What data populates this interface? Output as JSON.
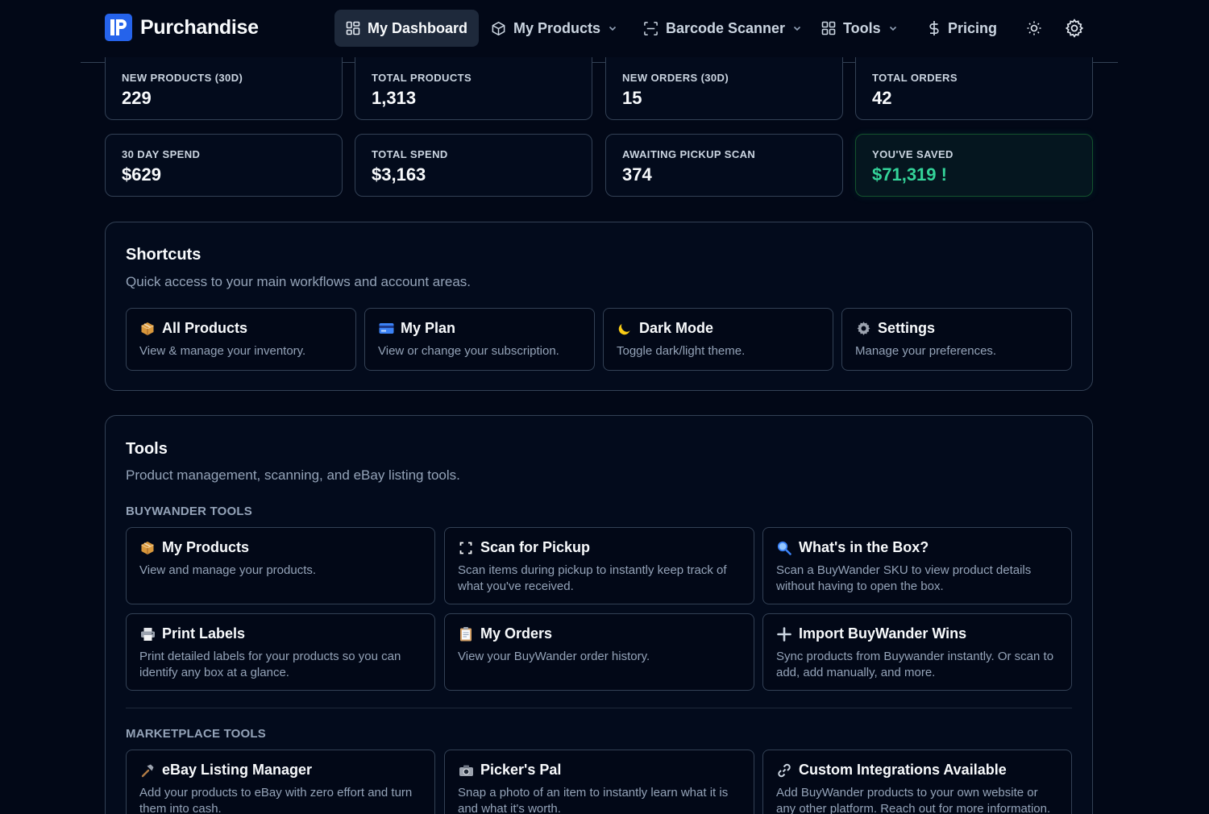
{
  "nav": {
    "brand": "Purchandise",
    "items": [
      {
        "label": "My Dashboard",
        "icon": "dashboard-icon",
        "active": true
      },
      {
        "label": "My Products",
        "icon": "box-icon",
        "dropdown": true
      },
      {
        "label": "Barcode Scanner",
        "icon": "scan-icon",
        "dropdown": true
      },
      {
        "label": "Tools",
        "icon": "grid-icon",
        "dropdown": true
      },
      {
        "label": "Pricing",
        "icon": "dollar-icon"
      }
    ],
    "theme_icon": "sun-icon",
    "settings_icon": "gear-icon"
  },
  "stats": {
    "new_products": {
      "label": "NEW PRODUCTS (30D)",
      "value": "229"
    },
    "total_products": {
      "label": "TOTAL PRODUCTS",
      "value": "1,313"
    },
    "new_orders": {
      "label": "NEW ORDERS (30D)",
      "value": "15"
    },
    "total_orders": {
      "label": "TOTAL ORDERS",
      "value": "42"
    },
    "spend_30": {
      "label": "30 DAY SPEND",
      "value": "$629"
    },
    "total_spend": {
      "label": "TOTAL SPEND",
      "value": "$3,163"
    },
    "awaiting": {
      "label": "AWAITING PICKUP SCAN",
      "value": "374"
    },
    "saved": {
      "label": "YOU'VE SAVED",
      "value": "$71,319 !"
    }
  },
  "shortcuts": {
    "title": "Shortcuts",
    "subtitle": "Quick access to your main workflows and account areas.",
    "items": [
      {
        "title": "All Products",
        "desc": "View & manage your inventory.",
        "icon": "package-icon"
      },
      {
        "title": "My Plan",
        "desc": "View or change your subscription.",
        "icon": "credit-card-icon"
      },
      {
        "title": "Dark Mode",
        "desc": "Toggle dark/light theme.",
        "icon": "moon-icon"
      },
      {
        "title": "Settings",
        "desc": "Manage your preferences.",
        "icon": "gear-icon"
      }
    ]
  },
  "tools": {
    "title": "Tools",
    "subtitle": "Product management, scanning, and eBay listing tools.",
    "buywander_label": "BUYWANDER TOOLS",
    "buywander": [
      {
        "title": "My Products",
        "desc": "View and manage your products.",
        "icon": "package-icon"
      },
      {
        "title": "Scan for Pickup",
        "desc": "Scan items during pickup to instantly keep track of what you've received.",
        "icon": "scan-icon"
      },
      {
        "title": "What's in the Box?",
        "desc": "Scan a BuyWander SKU to view product details without having to open the box.",
        "icon": "magnifier-icon"
      },
      {
        "title": "Print Labels",
        "desc": "Print detailed labels for your products so you can identify any box at a glance.",
        "icon": "printer-icon"
      },
      {
        "title": "My Orders",
        "desc": "View your BuyWander order history.",
        "icon": "clipboard-icon"
      },
      {
        "title": "Import BuyWander Wins",
        "desc": "Sync products from Buywander instantly. Or scan to add, add manually, and more.",
        "icon": "plus-icon"
      }
    ],
    "marketplace_label": "MARKETPLACE TOOLS",
    "marketplace": [
      {
        "title": "eBay Listing Manager",
        "desc": "Add your products to eBay with zero effort and turn them into cash.",
        "icon": "hammer-icon"
      },
      {
        "title": "Picker's Pal",
        "desc": "Snap a photo of an item to instantly learn what it is and what it's worth.",
        "icon": "camera-icon"
      },
      {
        "title": "Custom Integrations Available",
        "desc": "Add BuyWander products to your own website or any other platform. Reach out for more information.",
        "icon": "link-icon"
      }
    ]
  }
}
